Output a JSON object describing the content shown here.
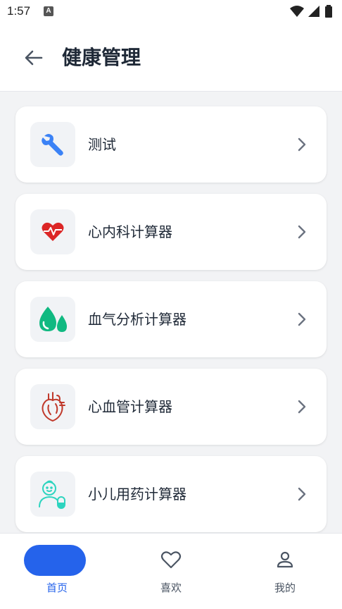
{
  "status_bar": {
    "time": "1:57",
    "notification_glyph": "A"
  },
  "header": {
    "title": "健康管理",
    "back_icon": "arrow-left-icon"
  },
  "items": [
    {
      "label": "测试",
      "icon": "wrench-icon",
      "icon_color": "#3b82f6"
    },
    {
      "label": "心内科计算器",
      "icon": "heart-pulse-icon",
      "icon_color": "#dc2626"
    },
    {
      "label": "血气分析计算器",
      "icon": "drops-icon",
      "icon_color": "#10b981"
    },
    {
      "label": "心血管计算器",
      "icon": "anatomical-heart-icon",
      "icon_color": "#c0392b"
    },
    {
      "label": "小儿用药计算器",
      "icon": "child-medicine-icon",
      "icon_color": "#2dd4bf"
    }
  ],
  "bottom_nav": [
    {
      "label": "首页",
      "icon": "home-pill-icon",
      "active": true
    },
    {
      "label": "喜欢",
      "icon": "heart-outline-icon",
      "active": false
    },
    {
      "label": "我的",
      "icon": "person-icon",
      "active": false
    }
  ],
  "colors": {
    "accent": "#2563eb",
    "background": "#f2f3f5",
    "card": "#ffffff"
  }
}
